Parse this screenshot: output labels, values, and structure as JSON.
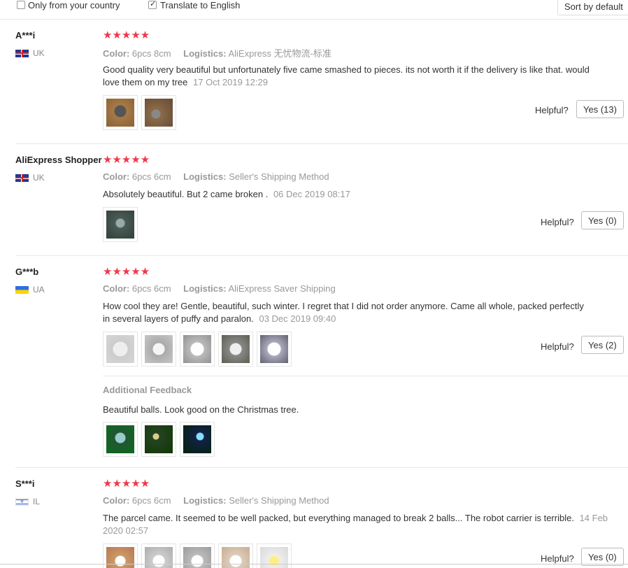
{
  "filters": {
    "only_country_label": "Only from your country",
    "only_country_checked": false,
    "translate_label": "Translate to English",
    "translate_checked": true,
    "sort_label": "Sort by default"
  },
  "labels": {
    "color": "Color:",
    "logistics": "Logistics:",
    "helpful": "Helpful?",
    "additional_feedback": "Additional Feedback"
  },
  "stars": "★★★★★",
  "reviews": [
    {
      "name": "A***i",
      "country": "UK",
      "color": "6pcs 8cm",
      "logistics": "AliExpress 无忧物流-标准",
      "text": "Good quality very beautiful but unfortunately five came smashed to pieces. its not worth it if the delivery is like that. would love them on my tree",
      "date": "17 Oct 2019 12:29",
      "yes": "Yes (13)"
    },
    {
      "name": "AliExpress Shopper",
      "country": "UK",
      "color": "6pcs 6cm",
      "logistics": "Seller's Shipping Method",
      "text": "Absolutely beautiful. But 2 came broken .",
      "date": "06 Dec 2019 08:17",
      "yes": "Yes (0)"
    },
    {
      "name": "G***b",
      "country": "UA",
      "color": "6pcs 6cm",
      "logistics": "AliExpress Saver Shipping",
      "text": "How cool they are! Gentle, beautiful, such winter. I regret that I did not order anymore. Came all whole, packed perfectly in several layers of puffy and paralon.",
      "date": "03 Dec 2019 09:40",
      "yes": "Yes (2)",
      "additional_text": "Beautiful balls. Look good on the Christmas tree."
    },
    {
      "name": "S***i",
      "country": "IL",
      "color": "6pcs 6cm",
      "logistics": "Seller's Shipping Method",
      "text": "The parcel came. It seemed to be well packed, but everything managed to break 2 balls... The robot carrier is terrible.",
      "date": "14 Feb 2020 02:57",
      "yes": "Yes (0)"
    }
  ]
}
